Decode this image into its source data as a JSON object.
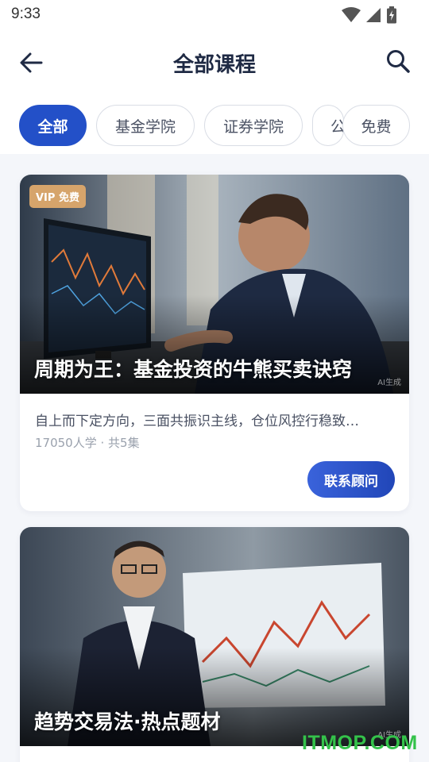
{
  "status_bar": {
    "time": "9:33"
  },
  "header": {
    "title": "全部课程"
  },
  "tabs": [
    {
      "label": "全部",
      "active": true
    },
    {
      "label": "基金学院"
    },
    {
      "label": "证券学院"
    },
    {
      "label": "公"
    },
    {
      "label": "免费"
    }
  ],
  "courses": [
    {
      "badge": "VIP 免费",
      "title": "周期为王：基金投资的牛熊买卖诀窍",
      "ai_tag": "AI生成",
      "description": "自上而下定方向，三面共振识主线，仓位风控行稳致…",
      "meta": "17050人学 · 共5集",
      "cta": "联系顾问"
    },
    {
      "title": "趋势交易法·热点题材",
      "ai_tag": "AI生成"
    }
  ],
  "watermark": "ITMOP.COM",
  "colors": {
    "accent": "#2350c8",
    "badge": "#d6a46b",
    "watermark": "#34c24a"
  }
}
